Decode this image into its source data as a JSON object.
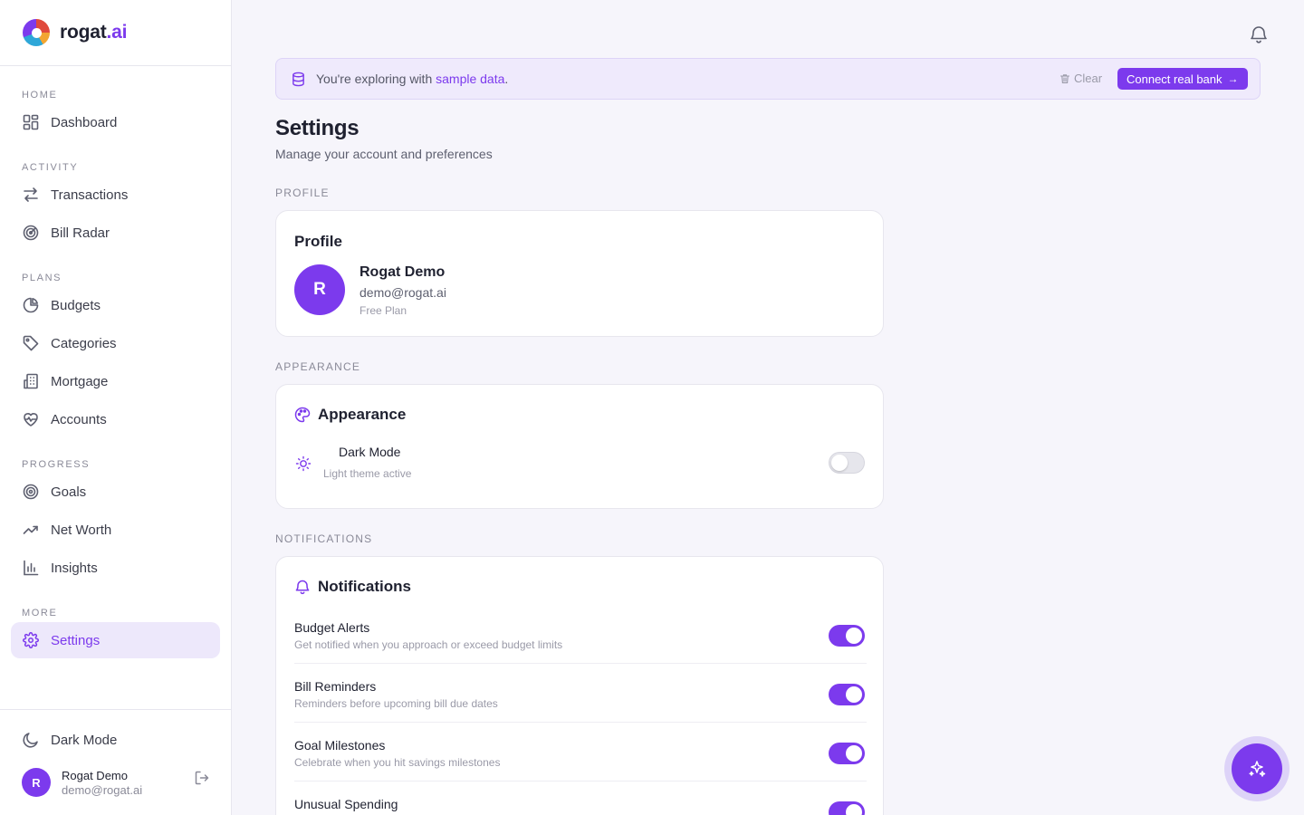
{
  "app": {
    "logo_main": "rogat",
    "logo_suffix": ".ai"
  },
  "sidebar": {
    "sections": {
      "home": "HOME",
      "activity": "ACTIVITY",
      "plans": "PLANS",
      "progress": "PROGRESS",
      "more": "MORE"
    },
    "items": {
      "dashboard": "Dashboard",
      "transactions": "Transactions",
      "bill_radar": "Bill Radar",
      "budgets": "Budgets",
      "categories": "Categories",
      "mortgage": "Mortgage",
      "accounts": "Accounts",
      "goals": "Goals",
      "net_worth": "Net Worth",
      "insights": "Insights",
      "settings": "Settings"
    },
    "active_item": "Settings",
    "dark_mode_label": "Dark Mode",
    "user": {
      "initial": "R",
      "name": "Rogat Demo",
      "email": "demo@rogat.ai"
    }
  },
  "banner": {
    "text_prefix": "You're exploring with ",
    "text_highlight": "sample data",
    "text_suffix": ".",
    "clear_label": "Clear",
    "connect_label": "Connect real bank"
  },
  "page": {
    "title": "Settings",
    "subtitle": "Manage your account and preferences"
  },
  "profile_section": {
    "label": "PROFILE",
    "card_title": "Profile",
    "initial": "R",
    "name": "Rogat Demo",
    "email": "demo@rogat.ai",
    "plan": "Free Plan"
  },
  "appearance_section": {
    "label": "APPEARANCE",
    "card_title": "Appearance",
    "dark_mode_title": "Dark Mode",
    "dark_mode_desc": "Light theme active",
    "dark_mode_enabled": false
  },
  "notifications_section": {
    "label": "NOTIFICATIONS",
    "card_title": "Notifications",
    "items": [
      {
        "title": "Budget Alerts",
        "desc": "Get notified when you approach or exceed budget limits",
        "enabled": true
      },
      {
        "title": "Bill Reminders",
        "desc": "Reminders before upcoming bill due dates",
        "enabled": true
      },
      {
        "title": "Goal Milestones",
        "desc": "Celebrate when you hit savings milestones",
        "enabled": true
      },
      {
        "title": "Unusual Spending",
        "desc": "",
        "enabled": true
      }
    ]
  },
  "colors": {
    "accent": "#7c3aed",
    "background": "#f6f5fb",
    "banner_bg": "#efeafc"
  },
  "icons": {
    "notifications": "bell-icon",
    "assistant": "sparkles-icon"
  }
}
